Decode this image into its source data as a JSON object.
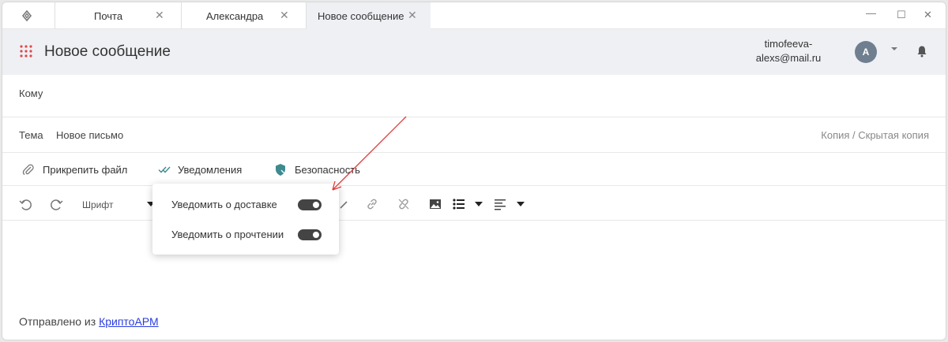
{
  "tabs": [
    {
      "label": "Почта",
      "active": false
    },
    {
      "label": "Александра",
      "active": false
    },
    {
      "label": "Новое сообщение",
      "active": true
    }
  ],
  "window_controls": [
    "minimize-icon",
    "maximize-icon",
    "close-icon"
  ],
  "header": {
    "title": "Новое сообщение",
    "user_email_line1": "timofeeva-",
    "user_email_line2": "alexs@mail.ru",
    "avatar_letter": "A"
  },
  "form": {
    "to_label": "Кому",
    "to_value": "",
    "subject_label": "Тема",
    "subject_value": "Новое письмо",
    "cc_bcc": "Копия / Скрытая копия"
  },
  "actions": {
    "attach": "Прикрепить файл",
    "notifications": "Уведомления",
    "security": "Безопасность"
  },
  "toolbar": {
    "font": "Шрифт"
  },
  "notifications_popover": {
    "delivery_label": "Уведомить о доставке",
    "delivery_on": true,
    "read_label": "Уведомить о прочтении",
    "read_on": true
  },
  "body": {
    "signature_prefix": "Отправлено из",
    "signature_link": "КриптоАРМ"
  },
  "colors": {
    "accent_red": "#e03a3a",
    "header_bg": "#eef0f4",
    "link": "#2a3ee0",
    "security_icon": "#3d8a8f"
  }
}
